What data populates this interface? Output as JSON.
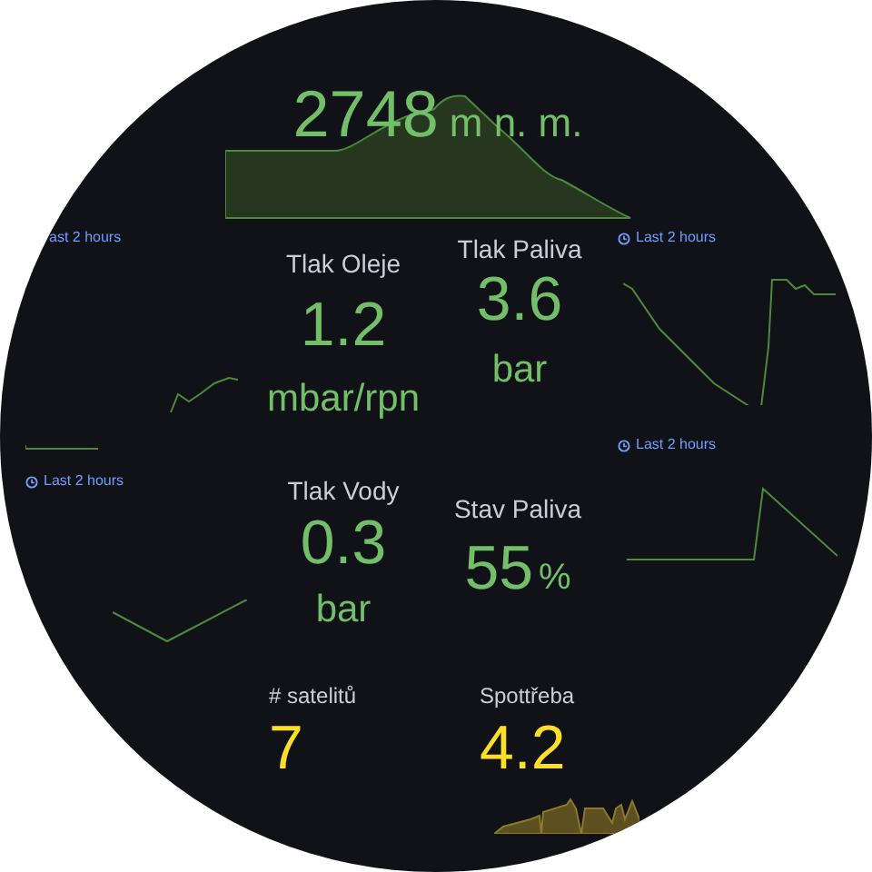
{
  "panels": [
    {
      "kind": "inline",
      "value": "2748",
      "unit": "m n. m.",
      "color": "#73bf69",
      "sparkline": true
    },
    {
      "kind": "stacked",
      "title": "Tlak Oleje",
      "value": "1.2",
      "unit": "mbar/rpn",
      "color": "#73bf69"
    },
    {
      "kind": "stacked",
      "title": "Tlak Paliva",
      "value": "3.6",
      "unit": "bar",
      "color": "#73bf69"
    },
    {
      "kind": "stacked",
      "title": "Tlak Vody",
      "value": "0.3",
      "unit": "bar",
      "color": "#73bf69"
    },
    {
      "kind": "inline",
      "title": "Stav Paliva",
      "value": "55",
      "unit": "%",
      "color": "#73bf69"
    },
    {
      "kind": "plain",
      "title": "# satelitů",
      "value": "7",
      "color": "#fade2a"
    },
    {
      "kind": "plain",
      "title": "Spottřeba",
      "value": "4.2",
      "color": "#fade2a",
      "sparkline": true
    }
  ],
  "time_labels": [
    {
      "text": "ast 2 hours",
      "icon": false
    },
    {
      "text": "Last 2 hours",
      "icon": true
    },
    {
      "text": "Last 2 hours",
      "icon": true
    },
    {
      "text": "Last 2 hours",
      "icon": true
    }
  ]
}
